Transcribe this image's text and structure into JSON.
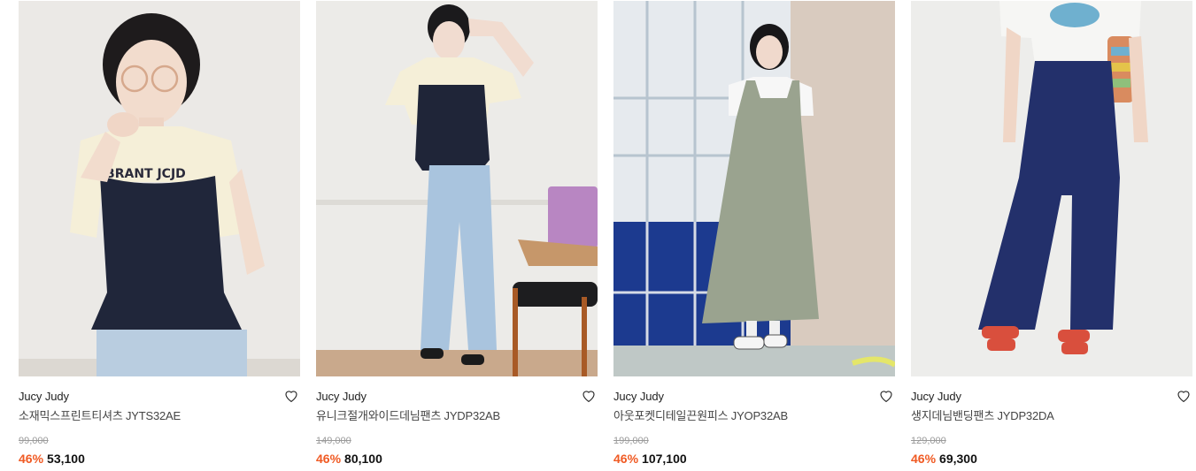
{
  "products": [
    {
      "brand": "Jucy Judy",
      "name": "소재믹스프린트티셔츠 JYTS32AE",
      "original_price": "99,000",
      "discount": "46%",
      "price": "53,100",
      "wishlist_icon": "heart-outline-icon"
    },
    {
      "brand": "Jucy Judy",
      "name": "유니크절개와이드데님팬츠 JYDP32AB",
      "original_price": "149,000",
      "discount": "46%",
      "price": "80,100",
      "wishlist_icon": "heart-outline-icon"
    },
    {
      "brand": "Jucy Judy",
      "name": "아웃포켓디테일끈원피스 JYOP32AB",
      "original_price": "199,000",
      "discount": "46%",
      "price": "107,100",
      "wishlist_icon": "heart-outline-icon"
    },
    {
      "brand": "Jucy Judy",
      "name": "생지데님밴딩팬츠 JYDP32DA",
      "original_price": "129,000",
      "discount": "46%",
      "price": "69,300",
      "wishlist_icon": "heart-outline-icon"
    }
  ],
  "colors": {
    "discount": "#f05a23",
    "price": "#111111",
    "original_price": "#9a9a9a"
  }
}
